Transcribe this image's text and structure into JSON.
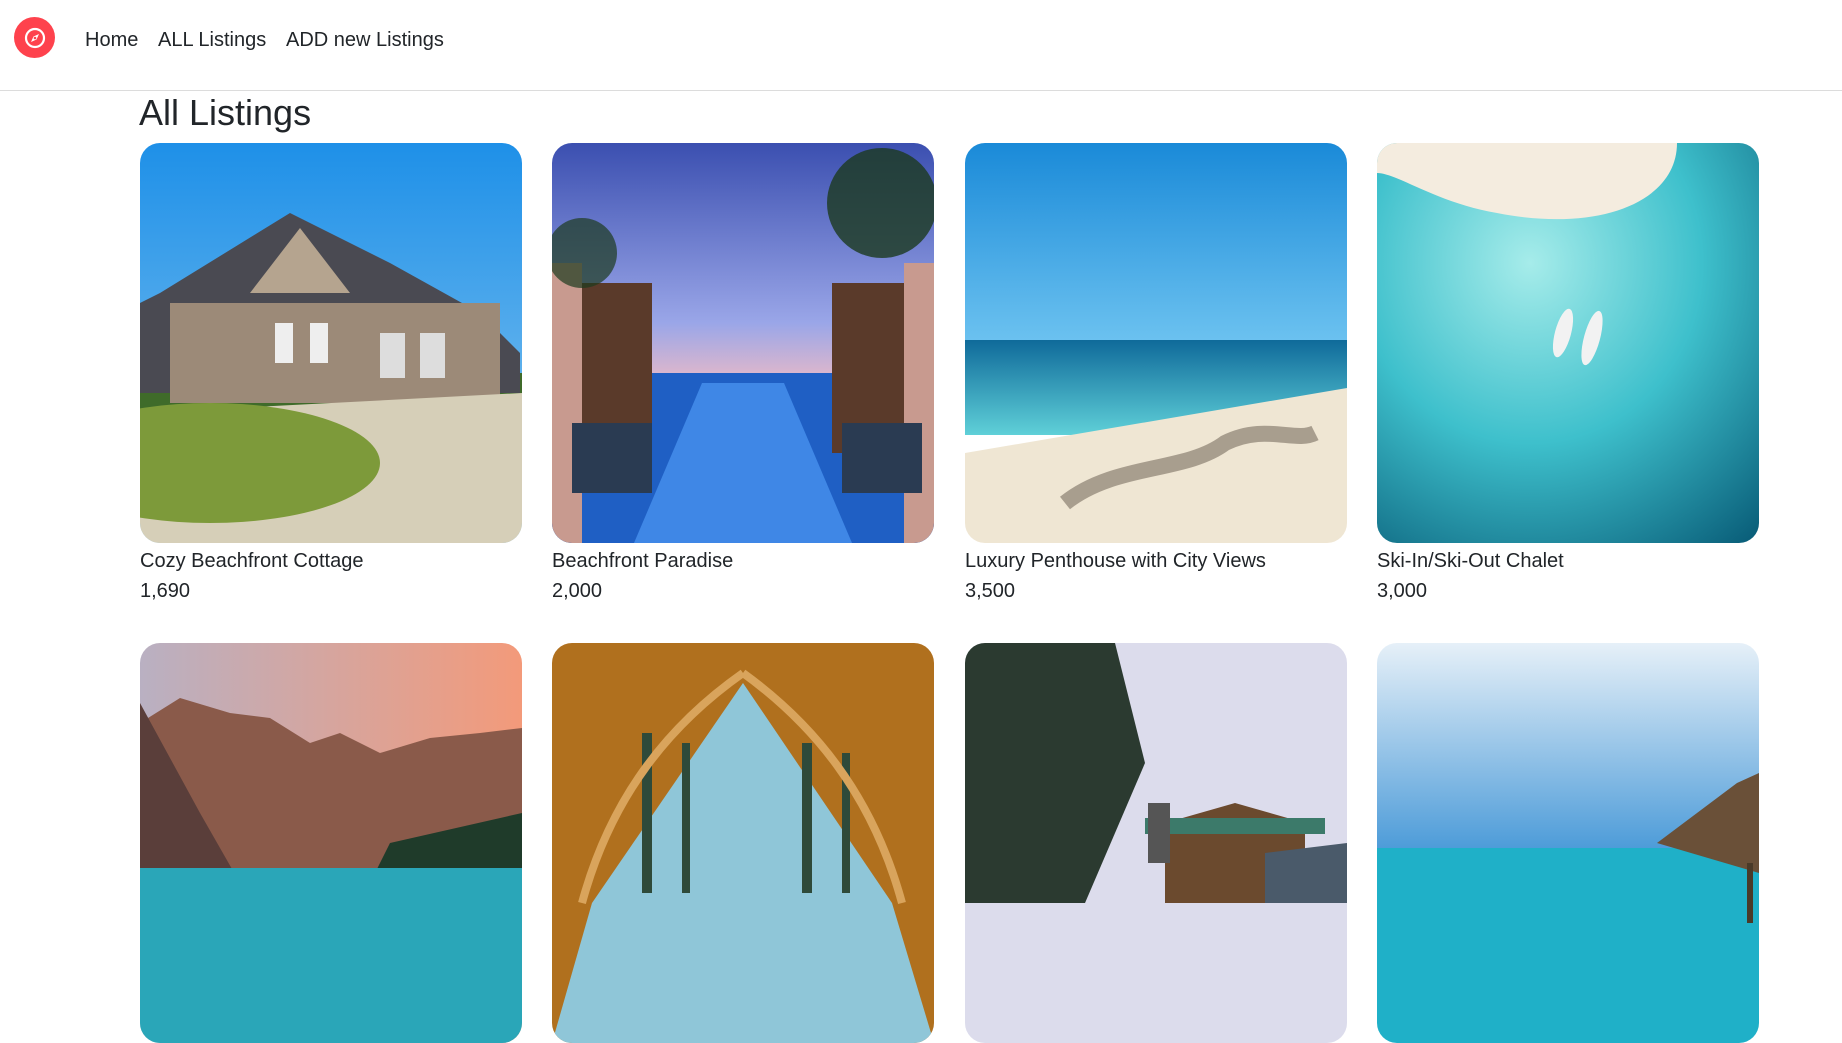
{
  "nav": {
    "brand_icon": "compass-icon",
    "brand_color": "#fe424d",
    "links": [
      "Home",
      "ALL Listings",
      "ADD new Listings"
    ]
  },
  "page": {
    "title": "All Listings"
  },
  "listings": [
    {
      "title": "Cozy Beachfront Cottage",
      "price": "1,690",
      "image": "suburban-house-photo"
    },
    {
      "title": "Beachfront Paradise",
      "price": "2,000",
      "image": "resort-pool-cabanas-photo"
    },
    {
      "title": "Luxury Penthouse with City Views",
      "price": "3,500",
      "image": "tropical-beach-photo"
    },
    {
      "title": "Ski-In/Ski-Out Chalet",
      "price": "3,000",
      "image": "aerial-turquoise-water-photo"
    },
    {
      "title": "",
      "price": "",
      "image": "mountain-lake-photo"
    },
    {
      "title": "",
      "price": "",
      "image": "tent-forest-view-photo"
    },
    {
      "title": "",
      "price": "",
      "image": "lakeside-cabin-photo"
    },
    {
      "title": "",
      "price": "",
      "image": "beach-hut-ocean-photo"
    }
  ]
}
